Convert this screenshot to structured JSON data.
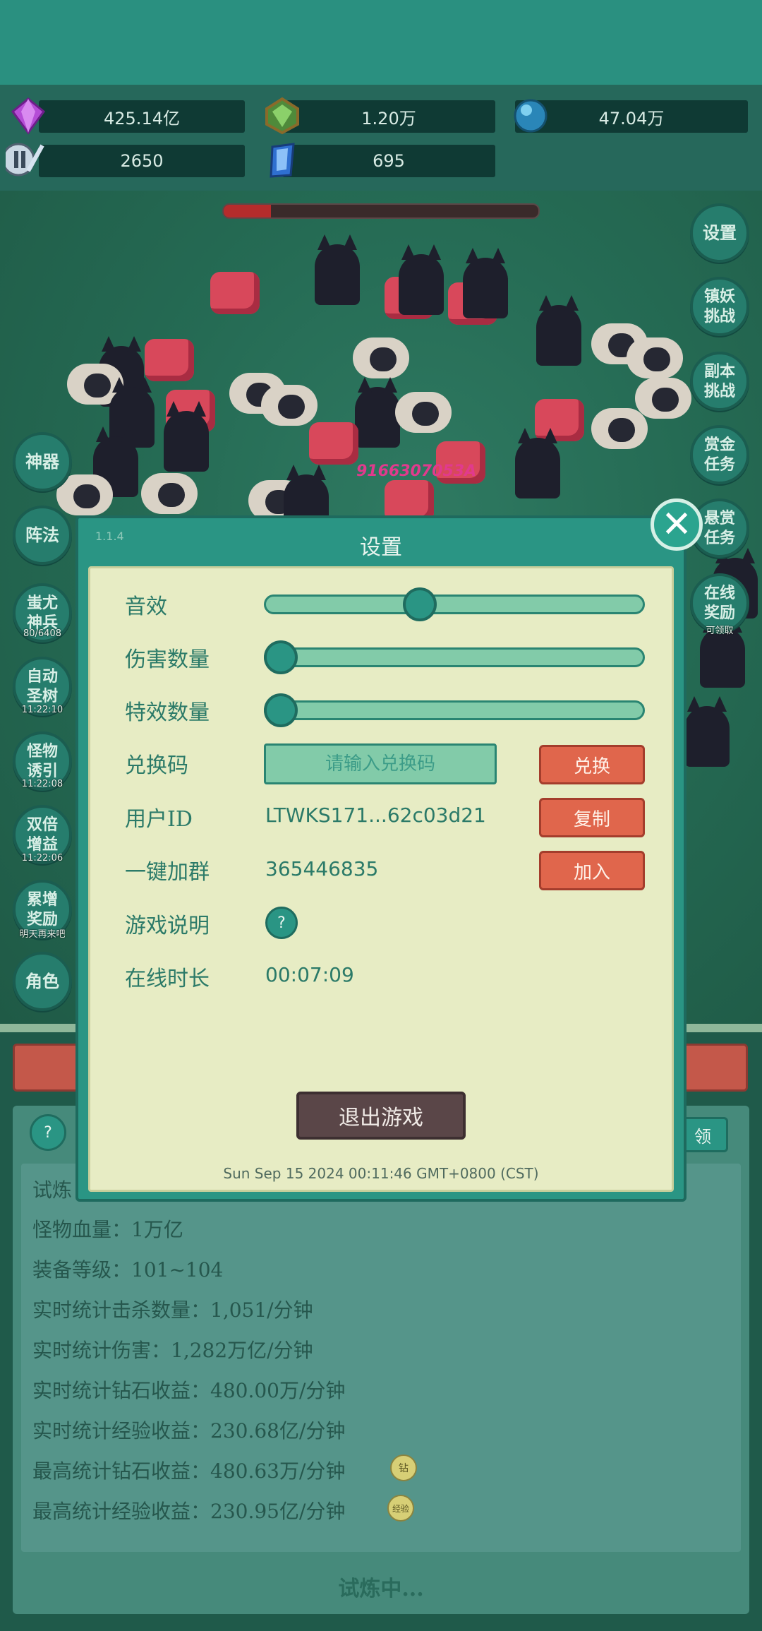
{
  "resources": [
    {
      "icon": "purple-diamond-icon",
      "value": "425.14亿"
    },
    {
      "icon": "green-crystal-icon",
      "value": "1.20万"
    },
    {
      "icon": "blue-orb-icon",
      "value": "47.04万"
    },
    {
      "icon": "sword-scroll-icon",
      "value": "2650"
    },
    {
      "icon": "blue-gem-icon",
      "value": "695"
    }
  ],
  "boss_hp_fraction": 0.15,
  "damage_text": "9166307053A",
  "left_buttons": [
    {
      "label": "神器",
      "sub": ""
    },
    {
      "label": "阵法",
      "sub": ""
    },
    {
      "label": "蚩尤神兵",
      "sub": "80/6408"
    },
    {
      "label": "自动圣树",
      "sub": "11:22:10"
    },
    {
      "label": "怪物诱引",
      "sub": "11:22:08"
    },
    {
      "label": "双倍增益",
      "sub": "11:22:06"
    },
    {
      "label": "累增奖励",
      "sub": "明天再来吧"
    },
    {
      "label": "角色",
      "sub": ""
    }
  ],
  "right_buttons": [
    {
      "label": "设置",
      "sub": ""
    },
    {
      "label": "镇妖挑战",
      "sub": ""
    },
    {
      "label": "副本挑战",
      "sub": ""
    },
    {
      "label": "赏金任务",
      "sub": ""
    },
    {
      "label": "悬赏任务",
      "sub": ""
    },
    {
      "label": "在线奖励",
      "sub": "可领取"
    }
  ],
  "modal": {
    "corner_label": "1.1.4",
    "title": "设置",
    "sound_label": "音效",
    "sound_level": 0.4,
    "damage_count_label": "伤害数量",
    "damage_count_level": 0.0,
    "effects_count_label": "特效数量",
    "effects_count_level": 0.0,
    "redeem_label": "兑换码",
    "redeem_placeholder": "请输入兑换码",
    "redeem_button": "兑换",
    "user_id_label": "用户ID",
    "user_id_value": "LTWKS171...62c03d21",
    "copy_button": "复制",
    "group_label": "一键加群",
    "group_value": "365446835",
    "join_button": "加入",
    "guide_label": "游戏说明",
    "guide_button": "?",
    "online_label": "在线时长",
    "online_value": "00:07:09",
    "quit_button": "退出游戏",
    "datetime": "Sun Sep 15 2024 00:11:46 GMT+0800 (CST)"
  },
  "lower": {
    "help_button": "?",
    "claim_button": "领",
    "trial_label": "试炼",
    "stats": [
      "怪物血量：1万亿",
      "装备等级：101~104",
      "实时统计击杀数量：1,051/分钟",
      "实时统计伤害：1,282万亿/分钟",
      "实时统计钻石收益：480.00万/分钟",
      "实时统计经验收益：230.68亿/分钟",
      "最高统计钻石收益：480.63万/分钟",
      "最高统计经验收益：230.95亿/分钟"
    ],
    "diamond_badge": "钻",
    "exp_badge": "经验",
    "status": "试炼中..."
  }
}
